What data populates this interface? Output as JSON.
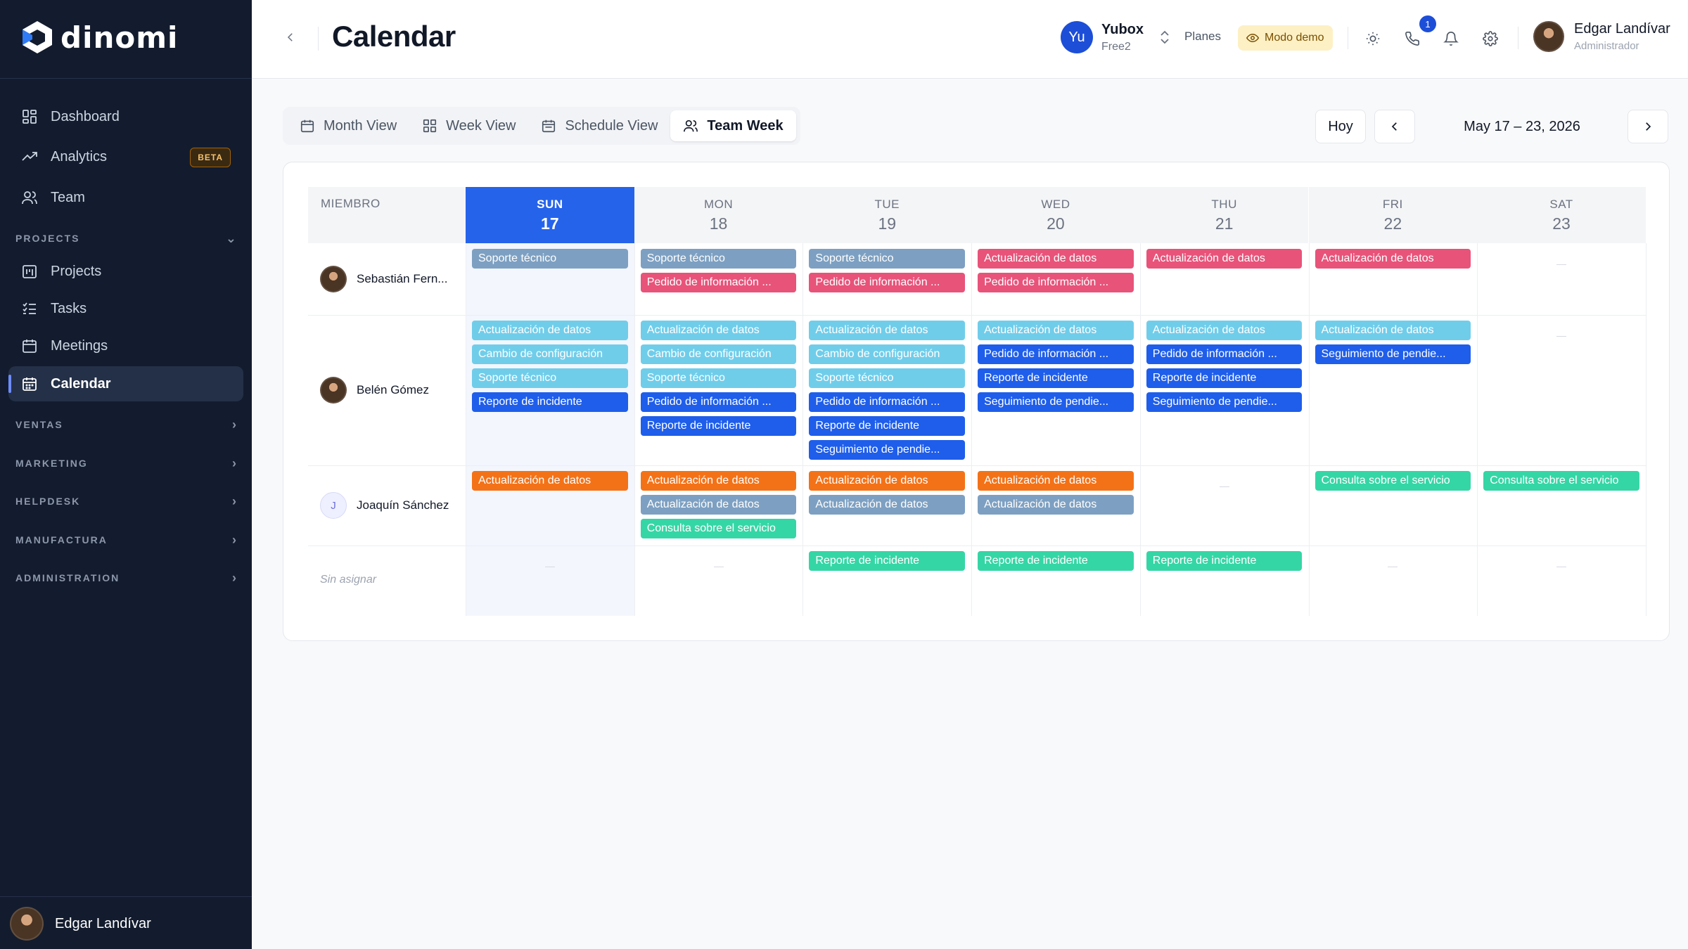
{
  "brand": {
    "name": "dinomi"
  },
  "sidebar": {
    "items": [
      {
        "label": "Dashboard",
        "icon": "dashboard-icon"
      },
      {
        "label": "Analytics",
        "icon": "analytics-icon",
        "badge": "BETA"
      },
      {
        "label": "Team",
        "icon": "team-icon"
      }
    ],
    "projects_section": "PROJECTS",
    "project_items": [
      {
        "label": "Projects",
        "icon": "projects-icon"
      },
      {
        "label": "Tasks",
        "icon": "tasks-icon"
      },
      {
        "label": "Meetings",
        "icon": "meetings-icon"
      },
      {
        "label": "Calendar",
        "icon": "calendar-icon",
        "active": true
      }
    ],
    "sections": [
      "VENTAS",
      "MARKETING",
      "HELPDESK",
      "MANUFACTURA",
      "ADMINISTRATION"
    ],
    "user_name": "Edgar Landívar"
  },
  "header": {
    "title": "Calendar",
    "org_initials": "Yu",
    "org_name": "Yubox",
    "org_plan": "Free2",
    "planes": "Planes",
    "demo": "Modo demo",
    "notif_count": "1",
    "user_name": "Edgar Landívar",
    "user_role": "Administrador"
  },
  "tabs": [
    {
      "label": "Month View",
      "icon": "calendar-icon"
    },
    {
      "label": "Week View",
      "icon": "grid-icon"
    },
    {
      "label": "Schedule View",
      "icon": "calendar-icon"
    },
    {
      "label": "Team Week",
      "icon": "users-icon",
      "active": true
    }
  ],
  "toolbar": {
    "today": "Hoy",
    "range": "May 17 – 23, 2026"
  },
  "calendar": {
    "member_header": "MIEMBRO",
    "days": [
      {
        "name": "SUN",
        "num": "17",
        "today": true
      },
      {
        "name": "MON",
        "num": "18"
      },
      {
        "name": "TUE",
        "num": "19"
      },
      {
        "name": "WED",
        "num": "20"
      },
      {
        "name": "THU",
        "num": "21"
      },
      {
        "name": "FRI",
        "num": "22"
      },
      {
        "name": "SAT",
        "num": "23"
      }
    ],
    "colors": {
      "gray": "#7da0c2",
      "red": "#e8537a",
      "cyan": "#70cdea",
      "blue": "#1f5eea",
      "orange": "#f47217",
      "green": "#35d6a5"
    },
    "rows": [
      {
        "member": "Sebastián Fern...",
        "avatar": "photo",
        "days": [
          [
            {
              "t": "Soporte técnico",
              "c": "gray"
            }
          ],
          [
            {
              "t": "Soporte técnico",
              "c": "gray"
            },
            {
              "t": "Pedido de información ...",
              "c": "red"
            }
          ],
          [
            {
              "t": "Soporte técnico",
              "c": "gray"
            },
            {
              "t": "Pedido de información ...",
              "c": "red"
            }
          ],
          [
            {
              "t": "Actualización de datos",
              "c": "red"
            },
            {
              "t": "Pedido de información ...",
              "c": "red"
            }
          ],
          [
            {
              "t": "Actualización de datos",
              "c": "red"
            }
          ],
          [
            {
              "t": "Actualización de datos",
              "c": "red"
            }
          ],
          []
        ]
      },
      {
        "member": "Belén Gómez",
        "avatar": "photo",
        "days": [
          [
            {
              "t": "Actualización de datos",
              "c": "cyan"
            },
            {
              "t": "Cambio de configuración",
              "c": "cyan"
            },
            {
              "t": "Soporte técnico",
              "c": "cyan"
            },
            {
              "t": "Reporte de incidente",
              "c": "blue"
            }
          ],
          [
            {
              "t": "Actualización de datos",
              "c": "cyan"
            },
            {
              "t": "Cambio de configuración",
              "c": "cyan"
            },
            {
              "t": "Soporte técnico",
              "c": "cyan"
            },
            {
              "t": "Pedido de información ...",
              "c": "blue"
            },
            {
              "t": "Reporte de incidente",
              "c": "blue"
            }
          ],
          [
            {
              "t": "Actualización de datos",
              "c": "cyan"
            },
            {
              "t": "Cambio de configuración",
              "c": "cyan"
            },
            {
              "t": "Soporte técnico",
              "c": "cyan"
            },
            {
              "t": "Pedido de información ...",
              "c": "blue"
            },
            {
              "t": "Reporte de incidente",
              "c": "blue"
            },
            {
              "t": "Seguimiento de pendie...",
              "c": "blue"
            }
          ],
          [
            {
              "t": "Actualización de datos",
              "c": "cyan"
            },
            {
              "t": "Pedido de información ...",
              "c": "blue"
            },
            {
              "t": "Reporte de incidente",
              "c": "blue"
            },
            {
              "t": "Seguimiento de pendie...",
              "c": "blue"
            }
          ],
          [
            {
              "t": "Actualización de datos",
              "c": "cyan"
            },
            {
              "t": "Pedido de información ...",
              "c": "blue"
            },
            {
              "t": "Reporte de incidente",
              "c": "blue"
            },
            {
              "t": "Seguimiento de pendie...",
              "c": "blue"
            }
          ],
          [
            {
              "t": "Actualización de datos",
              "c": "cyan"
            },
            {
              "t": "Seguimiento de pendie...",
              "c": "blue"
            }
          ],
          []
        ]
      },
      {
        "member": "Joaquín Sánchez",
        "avatar": "J",
        "days": [
          [
            {
              "t": "Actualización de datos",
              "c": "orange"
            }
          ],
          [
            {
              "t": "Actualización de datos",
              "c": "orange"
            },
            {
              "t": "Actualización de datos",
              "c": "gray"
            },
            {
              "t": "Consulta sobre el servicio",
              "c": "green"
            }
          ],
          [
            {
              "t": "Actualización de datos",
              "c": "orange"
            },
            {
              "t": "Actualización de datos",
              "c": "gray"
            }
          ],
          [
            {
              "t": "Actualización de datos",
              "c": "orange"
            },
            {
              "t": "Actualización de datos",
              "c": "gray"
            }
          ],
          [],
          [
            {
              "t": "Consulta sobre el servicio",
              "c": "green"
            }
          ],
          [
            {
              "t": "Consulta sobre el servicio",
              "c": "green"
            }
          ]
        ]
      },
      {
        "member": "Sin asignar",
        "avatar": "none",
        "days": [
          [],
          [],
          [
            {
              "t": "Reporte de incidente",
              "c": "green"
            }
          ],
          [
            {
              "t": "Reporte de incidente",
              "c": "green"
            }
          ],
          [
            {
              "t": "Reporte de incidente",
              "c": "green"
            }
          ],
          [],
          []
        ]
      }
    ]
  }
}
